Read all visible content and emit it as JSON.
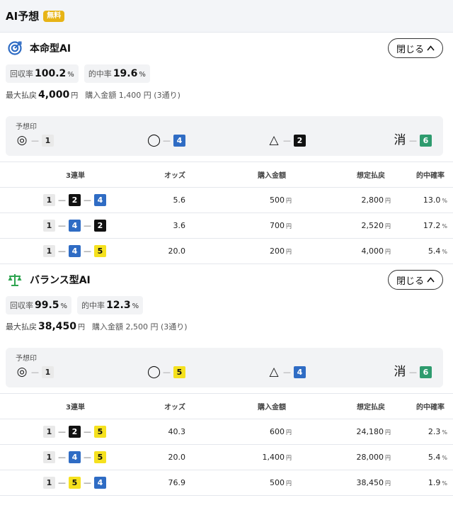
{
  "header": {
    "title": "AI予想",
    "badge": "無料"
  },
  "colors": {
    "badge": "#e7b416",
    "box_white": "#e9e9e9",
    "box_black": "#111111",
    "box_blue": "#2f6cc4",
    "box_yellow": "#f5e11e",
    "box_green": "#2e9b6e",
    "icon_blue": "#2f6cc4",
    "icon_green": "#2ea44f"
  },
  "sections": [
    {
      "icon": "target-icon",
      "title": "本命型AI",
      "close_label": "閉じる",
      "stats": [
        {
          "label": "回収率",
          "value": "100.2",
          "unit": "%"
        },
        {
          "label": "的中率",
          "value": "19.6",
          "unit": "%"
        }
      ],
      "payout": {
        "label": "最大払戻",
        "value": "4,000",
        "unit": "円",
        "purchase": "購入金額 1,400 円 (3通り)"
      },
      "marks": {
        "title": "予想印",
        "items": [
          {
            "symbol": "◎",
            "num": "1",
            "color": "c1"
          },
          {
            "symbol": "◯",
            "num": "4",
            "color": "c4"
          },
          {
            "symbol": "△",
            "num": "2",
            "color": "c2"
          },
          {
            "symbol": "消",
            "num": "6",
            "color": "c6"
          }
        ]
      },
      "columns": [
        "3連単",
        "オッズ",
        "購入金額",
        "想定払戻",
        "的中確率"
      ],
      "rows": [
        {
          "combo": [
            [
              "1",
              "c1"
            ],
            [
              "2",
              "c2"
            ],
            [
              "4",
              "c4"
            ]
          ],
          "odds": "5.6",
          "amount": "500",
          "payout": "2,800",
          "prob": "13.0"
        },
        {
          "combo": [
            [
              "1",
              "c1"
            ],
            [
              "4",
              "c4"
            ],
            [
              "2",
              "c2"
            ]
          ],
          "odds": "3.6",
          "amount": "700",
          "payout": "2,520",
          "prob": "17.2"
        },
        {
          "combo": [
            [
              "1",
              "c1"
            ],
            [
              "4",
              "c4"
            ],
            [
              "5",
              "c5"
            ]
          ],
          "odds": "20.0",
          "amount": "200",
          "payout": "4,000",
          "prob": "5.4"
        }
      ]
    },
    {
      "icon": "balance-scale-icon",
      "title": "バランス型AI",
      "close_label": "閉じる",
      "stats": [
        {
          "label": "回収率",
          "value": "99.5",
          "unit": "%"
        },
        {
          "label": "的中率",
          "value": "12.3",
          "unit": "%"
        }
      ],
      "payout": {
        "label": "最大払戻",
        "value": "38,450",
        "unit": "円",
        "purchase": "購入金額 2,500 円 (3通り)"
      },
      "marks": {
        "title": "予想印",
        "items": [
          {
            "symbol": "◎",
            "num": "1",
            "color": "c1"
          },
          {
            "symbol": "◯",
            "num": "5",
            "color": "c5"
          },
          {
            "symbol": "△",
            "num": "4",
            "color": "c4"
          },
          {
            "symbol": "消",
            "num": "6",
            "color": "c6"
          }
        ]
      },
      "columns": [
        "3連単",
        "オッズ",
        "購入金額",
        "想定払戻",
        "的中確率"
      ],
      "rows": [
        {
          "combo": [
            [
              "1",
              "c1"
            ],
            [
              "2",
              "c2"
            ],
            [
              "5",
              "c5"
            ]
          ],
          "odds": "40.3",
          "amount": "600",
          "payout": "24,180",
          "prob": "2.3"
        },
        {
          "combo": [
            [
              "1",
              "c1"
            ],
            [
              "4",
              "c4"
            ],
            [
              "5",
              "c5"
            ]
          ],
          "odds": "20.0",
          "amount": "1,400",
          "payout": "28,000",
          "prob": "5.4"
        },
        {
          "combo": [
            [
              "1",
              "c1"
            ],
            [
              "5",
              "c5"
            ],
            [
              "4",
              "c4"
            ]
          ],
          "odds": "76.9",
          "amount": "500",
          "payout": "38,450",
          "prob": "1.9"
        }
      ]
    }
  ],
  "units": {
    "yen": "円",
    "percent": "%"
  }
}
